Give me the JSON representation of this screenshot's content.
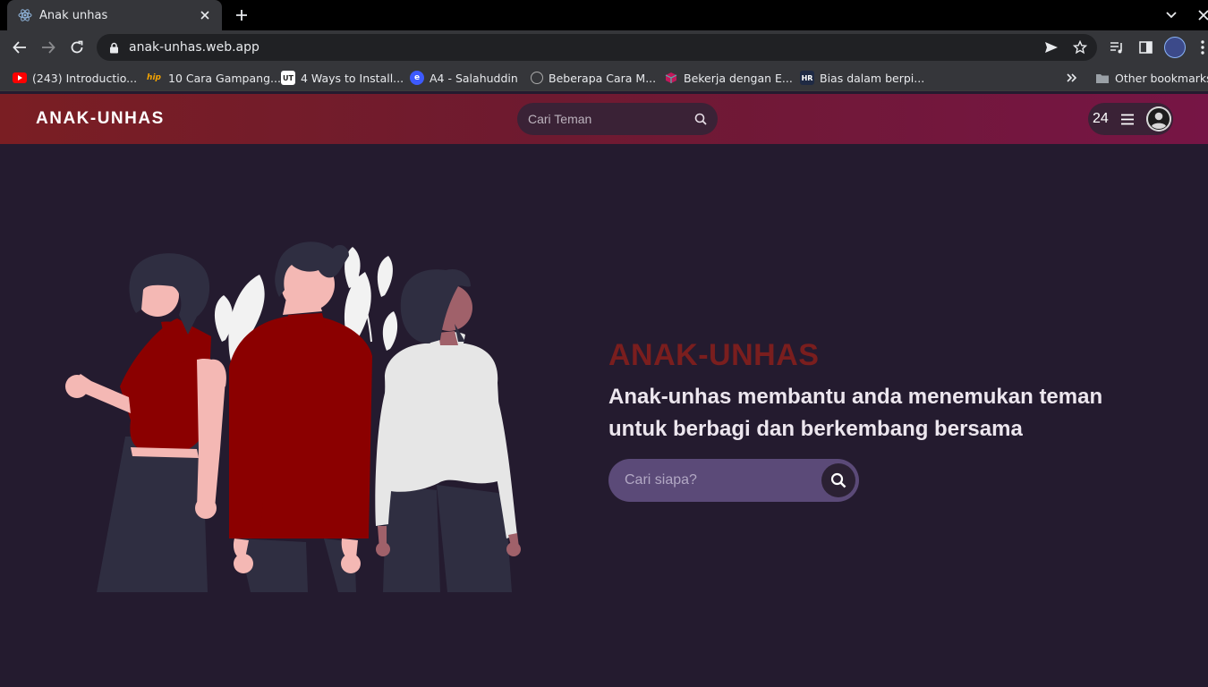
{
  "browser": {
    "tab_title": "Anak unhas",
    "url": "anak-unhas.web.app",
    "bookmarks": [
      {
        "label": "(243) Introductio...",
        "icon": "youtube-icon"
      },
      {
        "label": "10 Cara Gampang...",
        "icon": "hip-icon"
      },
      {
        "label": "4 Ways to Install...",
        "icon": "ut-icon"
      },
      {
        "label": "A4 - Salahuddin",
        "icon": "edge-icon"
      },
      {
        "label": "Beberapa Cara M...",
        "icon": "mask-icon"
      },
      {
        "label": "Bekerja dengan E...",
        "icon": "cube-icon"
      },
      {
        "label": "Bias dalam berpi...",
        "icon": "hr-icon"
      }
    ],
    "other_bookmarks": "Other bookmarks"
  },
  "header": {
    "brand": "ANAK-UNHAS",
    "search_placeholder": "Cari Teman",
    "count": "24"
  },
  "hero": {
    "title": "ANAK-UNHAS",
    "subtitle": "Anak-unhas membantu anda menemukan teman untuk berbagi dan berkembang bersama",
    "search_placeholder": "Cari siapa?"
  },
  "colors": {
    "page_bg": "#241b2f",
    "header_start": "#7a1e23",
    "header_end": "#761545",
    "accent_title": "#7a1e1e",
    "hero_search_bg": "#5b4a78",
    "shirt_red": "#8b0000"
  }
}
